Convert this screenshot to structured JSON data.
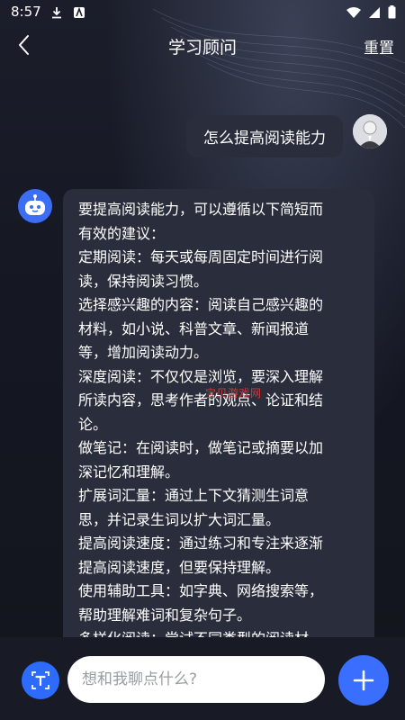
{
  "status_bar": {
    "time": "8:57",
    "left_icons": [
      "download-icon",
      "app-a-icon"
    ],
    "right_icons": [
      "wifi-icon",
      "signal-icon",
      "battery-icon"
    ]
  },
  "header": {
    "back_icon": "back-arrow-icon",
    "title": "学习顾问",
    "reset_label": "重置"
  },
  "messages": {
    "user": {
      "text": "怎么提高阅读能力",
      "avatar_icon": "user-avatar"
    },
    "bot": {
      "avatar_icon": "robot-icon",
      "lines": [
        "要提高阅读能力，可以遵循以下简短而",
        "有效的建议：",
        "定期阅读：每天或每周固定时间进行阅",
        "读，保持阅读习惯。",
        "选择感兴趣的内容：阅读自己感兴趣的",
        "材料，如小说、科普文章、新闻报道",
        "等，增加阅读动力。",
        "深度阅读：不仅仅是浏览，要深入理解",
        "所读内容，思考作者的观点、论证和结",
        "论。",
        "做笔记：在阅读时，做笔记或摘要以加",
        "深记忆和理解。",
        "扩展词汇量：通过上下文猜测生词意",
        "思，并记录生词以扩大词汇量。",
        "提高阅读速度：通过练习和专注来逐渐",
        "提高阅读速度，但要保持理解。",
        "使用辅助工具：如字典、网络搜索等，",
        "帮助理解难词和复杂句子。",
        "多样化阅读：尝试不同类型的阅读材"
      ]
    }
  },
  "watermark": "宝贝游戏网",
  "input_bar": {
    "text_mode_icon": "text-mode-icon",
    "placeholder": "想和我聊点什么?",
    "value": "",
    "add_icon": "plus-icon"
  },
  "colors": {
    "accent": "#3a6eff",
    "bubble": "#2a2e3c",
    "background": "#14161f",
    "watermark": "#e03b3b"
  }
}
